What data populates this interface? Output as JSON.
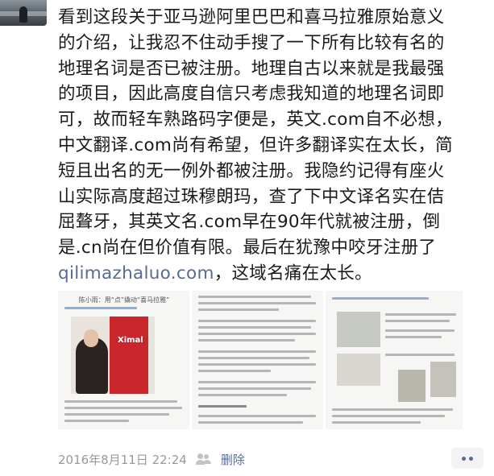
{
  "post": {
    "lines": [
      "看到这段关于亚马逊阿里巴巴和喜马拉雅原始意义",
      "的介绍，让我忍不住动手搜了一下所有比较有名的",
      "地理名词是否已被注册。地理自古以来就是我最强",
      "的项目，因此高度自信只考虑我知道的地理名词即",
      "可，故而轻车熟路码字便是，英文.com自不必想，",
      "中文翻译.com尚有希望，但许多翻译实在太长，简",
      "短且出名的无一例外都被注册。我隐约记得有座火",
      "山实际高度超过珠穆朗玛，查了下中文译名实在佶",
      "屈聱牙，其英文名.com早在90年代就被注册，倒",
      "是.cn尚在但价值有限。最后在犹豫中咬牙注册了"
    ],
    "link": "qilimazhaluo.com",
    "tail": "，这域名痛在太长。"
  },
  "images": {
    "thumb1_headline": "陈小雨：用“点”撬动“喜马拉雅”",
    "thumb1_logo": "Ximal"
  },
  "meta": {
    "timestamp": "2016年8月11日 22:24",
    "delete_label": "删除"
  },
  "colors": {
    "link": "#576b95",
    "text": "#1a1a1a",
    "meta": "#9a9a9a"
  }
}
